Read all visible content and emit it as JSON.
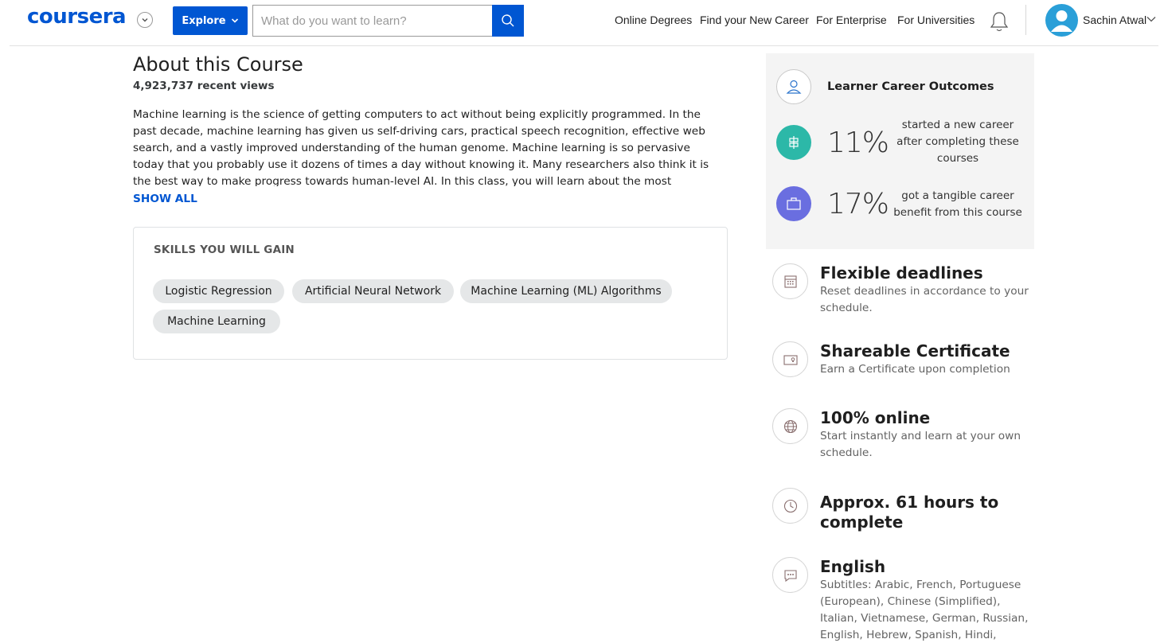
{
  "header": {
    "logo": "coursera",
    "explore_label": "Explore",
    "search_placeholder": "What do you want to learn?",
    "nav": [
      "Online Degrees",
      "Find your New Career",
      "For Enterprise",
      "For Universities"
    ],
    "user_name": "Sachin Atwal",
    "accent": "#0056d2"
  },
  "about": {
    "title": "About this Course",
    "views": "4,923,737 recent views",
    "description": "Machine learning is the science of getting computers to act without being explicitly programmed. In the past decade, machine learning has given us self-driving cars, practical speech recognition, effective web search, and a vastly improved understanding of the human genome. Machine learning is so pervasive today that you probably use it dozens of times a day without knowing it. Many researchers also think it is the best way to make progress towards human-level AI. In this class, you will learn about the most effective machine learning techniques, and",
    "show_all": "SHOW ALL"
  },
  "skills": {
    "title": "SKILLS YOU WILL GAIN",
    "items": [
      "Logistic Regression",
      "Artificial Neural Network",
      "Machine Learning (ML) Algorithms",
      "Machine Learning"
    ]
  },
  "outcomes": {
    "title": "Learner Career Outcomes",
    "items": [
      {
        "percent": "11%",
        "desc": "started a new career after completing these courses",
        "icon": "signpost-icon",
        "color": "#2cb8a8"
      },
      {
        "percent": "17%",
        "desc": "got a tangible career benefit from this course",
        "icon": "briefcase-icon",
        "color": "#6a6ee0"
      }
    ]
  },
  "features": [
    {
      "title": "Flexible deadlines",
      "desc": "Reset deadlines in accordance to your schedule.",
      "icon": "calendar-icon"
    },
    {
      "title": "Shareable Certificate",
      "desc": "Earn a Certificate upon completion",
      "icon": "certificate-icon"
    },
    {
      "title": "100% online",
      "desc": "Start instantly and learn at your own schedule.",
      "icon": "globe-icon"
    },
    {
      "title": "Approx. 61 hours to complete",
      "desc": "",
      "icon": "clock-icon"
    },
    {
      "title": "English",
      "desc": "Subtitles: Arabic, French, Portuguese (European), Chinese (Simplified), Italian, Vietnamese, German, Russian, English, Hebrew, Spanish, Hindi, Japanese",
      "icon": "chat-icon"
    }
  ]
}
